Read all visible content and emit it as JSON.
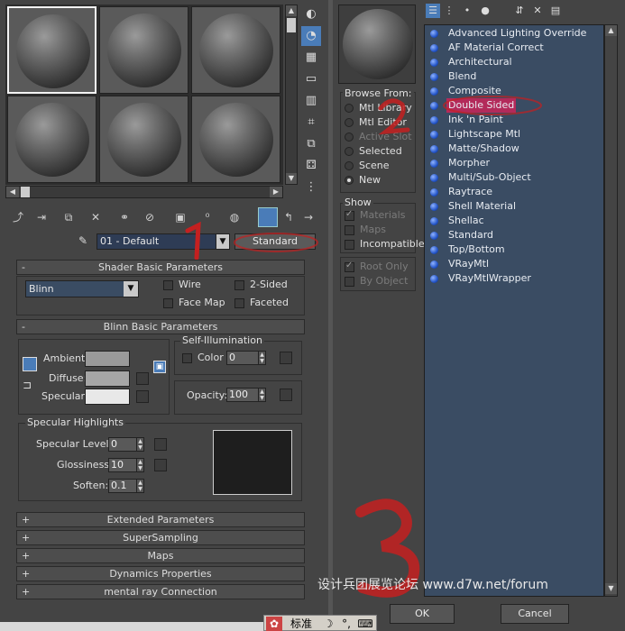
{
  "material_editor": {
    "material_name": "01 - Default",
    "material_type": "Standard",
    "shader_rollout": {
      "title": "Shader Basic Parameters",
      "collapse_sign": "-",
      "shader": "Blinn",
      "wire": "Wire",
      "two_sided": "2-Sided",
      "face_map": "Face Map",
      "faceted": "Faceted"
    },
    "blinn_rollout": {
      "title": "Blinn Basic Parameters",
      "collapse_sign": "-",
      "ambient": "Ambient:",
      "diffuse": "Diffuse:",
      "specular": "Specular:",
      "self_illumination": "Self-Illumination",
      "color_label": "Color",
      "color_value": "0",
      "opacity_label": "Opacity:",
      "opacity_value": "100",
      "specular_highlights": "Specular Highlights",
      "specular_level_label": "Specular Level:",
      "specular_level_value": "0",
      "glossiness_label": "Glossiness:",
      "glossiness_value": "10",
      "soften_label": "Soften:",
      "soften_value": "0.1"
    },
    "collapsed_rollouts": [
      {
        "sign": "+",
        "title": "Extended Parameters"
      },
      {
        "sign": "+",
        "title": "SuperSampling"
      },
      {
        "sign": "+",
        "title": "Maps"
      },
      {
        "sign": "+",
        "title": "Dynamics Properties"
      },
      {
        "sign": "+",
        "title": "mental ray Connection"
      }
    ],
    "annotation_1": "1"
  },
  "browser": {
    "browse_from_title": "Browse From:",
    "browse_from": [
      {
        "label": "Mtl Library",
        "selected": false,
        "enabled": true
      },
      {
        "label": "Mtl Editor",
        "selected": false,
        "enabled": true
      },
      {
        "label": "Active Slot",
        "selected": false,
        "enabled": false
      },
      {
        "label": "Selected",
        "selected": false,
        "enabled": true
      },
      {
        "label": "Scene",
        "selected": false,
        "enabled": true
      },
      {
        "label": "New",
        "selected": true,
        "enabled": true
      }
    ],
    "show_title": "Show",
    "show": [
      {
        "label": "Materials",
        "enabled": false
      },
      {
        "label": "Maps",
        "enabled": false
      },
      {
        "label": "Incompatible",
        "enabled": true
      }
    ],
    "root_only": "Root Only",
    "by_object": "By Object",
    "materials": [
      "Advanced Lighting Override",
      "AF Material Correct",
      "Architectural",
      "Blend",
      "Composite",
      "Double Sided",
      "Ink 'n Paint",
      "Lightscape Mtl",
      "Matte/Shadow",
      "Morpher",
      "Multi/Sub-Object",
      "Raytrace",
      "Shell Material",
      "Shellac",
      "Standard",
      "Top/Bottom",
      "VRayMtl",
      "VRayMtlWrapper"
    ],
    "selected_material": "Double Sided",
    "ok_label": "OK",
    "cancel_label": "Cancel",
    "annotation_2": "2",
    "annotation_3": "3"
  },
  "watermark": "设计兵团展览论坛 www.d7w.net/forum",
  "ime_bar": {
    "mode": "标准",
    "moon": "☽",
    "punct": "°,",
    "keyboard": "⌨"
  },
  "colors": {
    "panel_bg": "#444444",
    "list_bg": "#3a4c63",
    "selection": "#b32a5a",
    "annotation_red": "#c42020"
  }
}
